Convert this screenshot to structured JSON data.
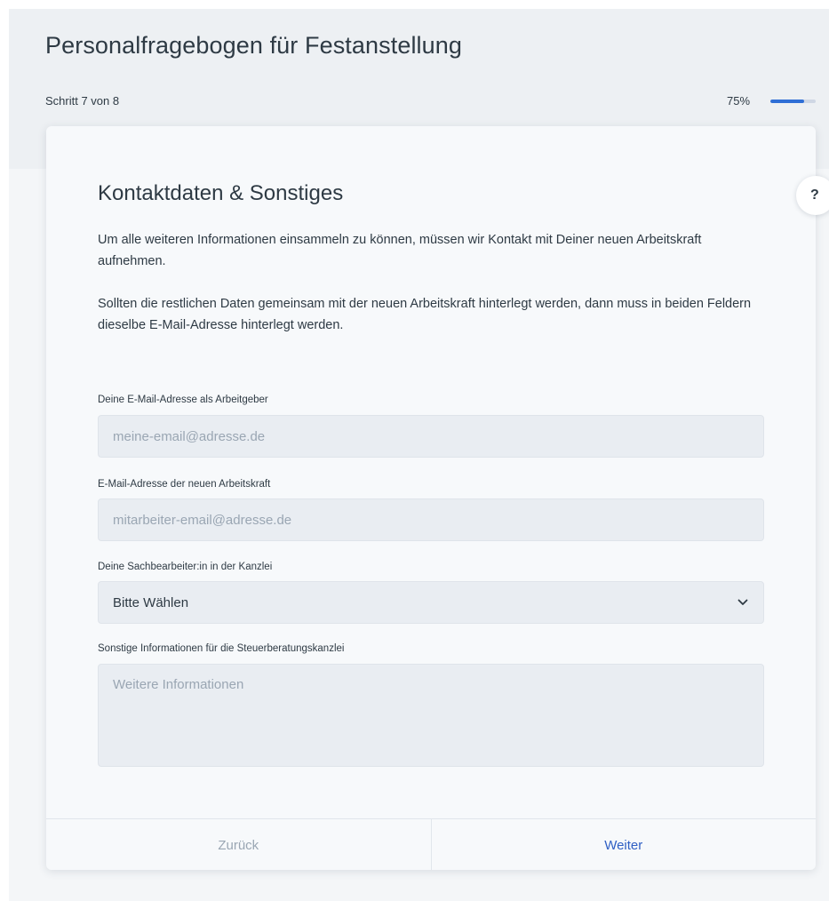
{
  "header": {
    "title": "Personalfragebogen für Festanstellung",
    "step_label": "Schritt 7 von 8",
    "progress_label": "75%",
    "progress_value": 75
  },
  "help": {
    "label": "?"
  },
  "section": {
    "title": "Kontaktdaten & Sonstiges",
    "intro_1": "Um alle weiteren Informationen einsammeln zu können, müssen wir Kontakt mit Deiner neuen Arbeitskraft aufnehmen.",
    "intro_2": "Sollten die restlichen Daten gemeinsam mit der neuen Arbeitskraft hinterlegt werden, dann muss in beiden Feldern dieselbe E-Mail-Adresse hinterlegt werden."
  },
  "fields": {
    "employer_email": {
      "label": "Deine E-Mail-Adresse als Arbeitgeber",
      "value": "",
      "placeholder": "meine-email@adresse.de"
    },
    "employee_email": {
      "label": "E-Mail-Adresse der neuen Arbeitskraft",
      "value": "",
      "placeholder": "mitarbeiter-email@adresse.de"
    },
    "clerk": {
      "label": "Deine Sachbearbeiter:in in der Kanzlei",
      "selected": "Bitte Wählen"
    },
    "notes": {
      "label": "Sonstige Informationen für die Steuerberatungskanzlei",
      "value": "",
      "placeholder": "Weitere Informationen"
    }
  },
  "footer": {
    "back_label": "Zurück",
    "next_label": "Weiter"
  },
  "colors": {
    "accent": "#2f6fd6",
    "next_text": "#2f5fc4",
    "muted_text": "#9aa6b3"
  }
}
